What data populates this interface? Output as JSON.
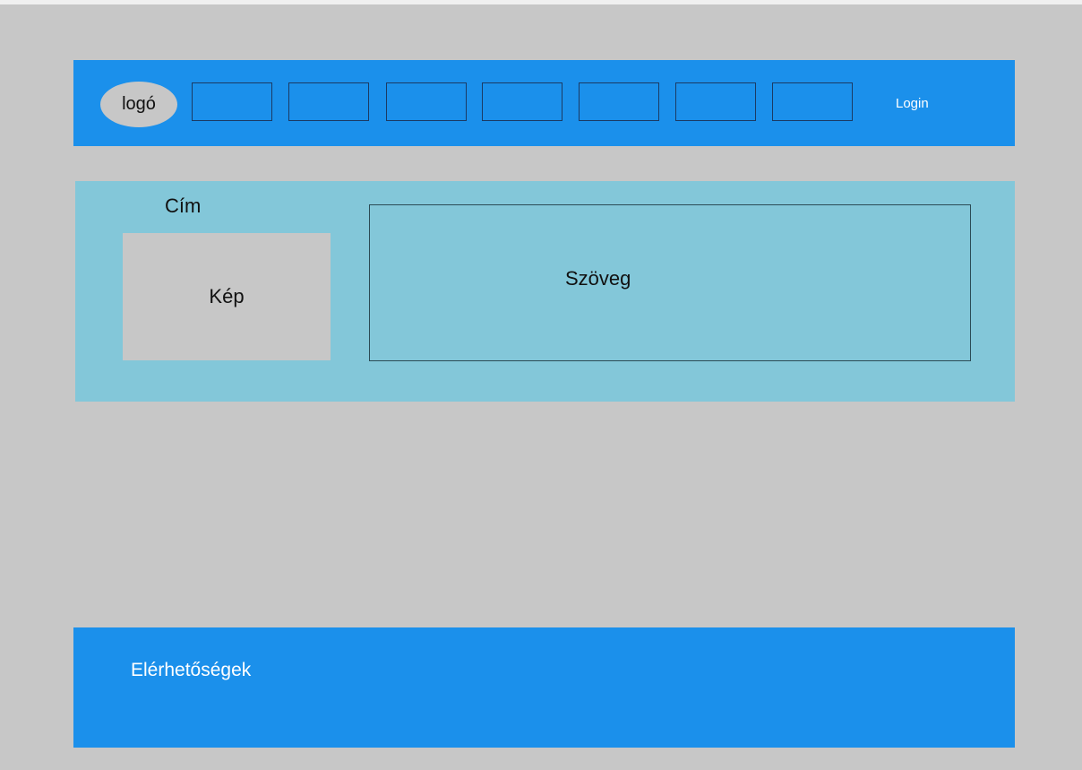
{
  "header": {
    "logo_label": "logó",
    "login_label": "Login"
  },
  "content": {
    "title": "Cím",
    "image_label": "Kép",
    "text_label": "Szöveg"
  },
  "footer": {
    "label": "Elérhetőségek"
  },
  "colors": {
    "page_background": "#c7c7c7",
    "header_footer": "#1b90eb",
    "content_background": "#83c7d9"
  }
}
